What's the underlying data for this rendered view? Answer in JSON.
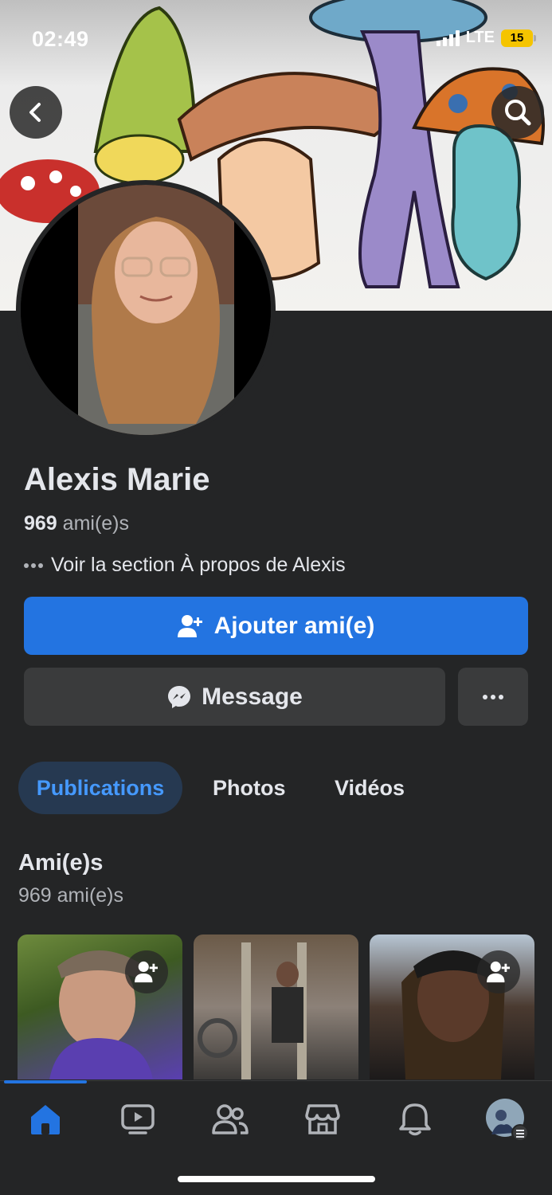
{
  "status_bar": {
    "time": "02:49",
    "network": "LTE",
    "battery": "15"
  },
  "profile": {
    "name": "Alexis Marie",
    "friends_count": "969",
    "friends_label": "ami(e)s",
    "about_text": "Voir la section À propos de Alexis"
  },
  "actions": {
    "add_friend_label": "Ajouter ami(e)",
    "message_label": "Message"
  },
  "tabs": [
    {
      "label": "Publications",
      "active": true
    },
    {
      "label": "Photos",
      "active": false
    },
    {
      "label": "Vidéos",
      "active": false
    }
  ],
  "friends_section": {
    "title": "Ami(e)s",
    "subtitle": "969 ami(e)s"
  },
  "bottom_nav": {
    "items": [
      "home-icon",
      "video-icon",
      "friends-icon",
      "marketplace-icon",
      "bell-icon",
      "profile-menu-icon"
    ],
    "active": "home-icon"
  },
  "colors": {
    "accent": "#2374e1",
    "background": "#242526",
    "button_secondary": "#3a3b3c",
    "tab_active_bg": "#263951",
    "tab_active_text": "#4599ff"
  }
}
